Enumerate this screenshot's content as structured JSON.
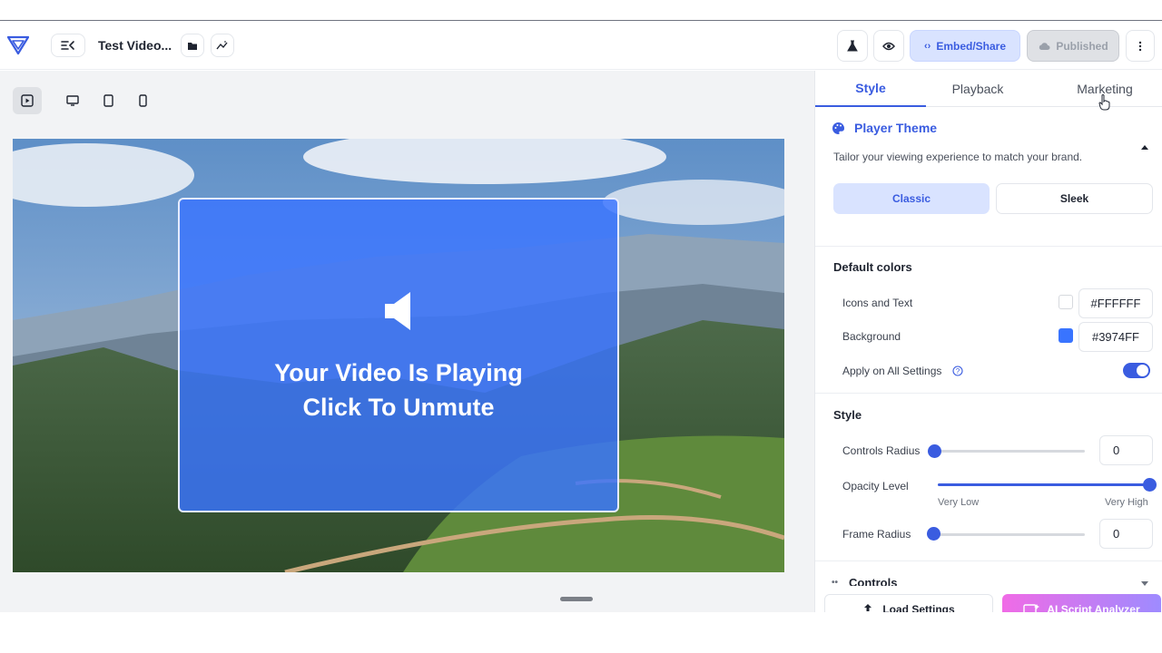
{
  "header": {
    "title": "Test Video...",
    "embed_label": "Embed/Share",
    "published_label": "Published"
  },
  "canvas": {
    "overlay_line1": "Your Video Is Playing",
    "overlay_line2": "Click To Unmute"
  },
  "tabs": [
    {
      "label": "Style",
      "active": true
    },
    {
      "label": "Playback",
      "active": false
    },
    {
      "label": "Marketing",
      "active": false
    }
  ],
  "player_theme": {
    "title": "Player Theme",
    "description": "Tailor your viewing experience to match your brand.",
    "options": [
      "Classic",
      "Sleek"
    ],
    "selected": "Classic"
  },
  "default_colors": {
    "title": "Default colors",
    "icons_text_label": "Icons and Text",
    "icons_text_value": "#FFFFFF",
    "background_label": "Background",
    "background_value": "#3974FF",
    "apply_all_label": "Apply on All Settings",
    "apply_all_on": true
  },
  "style": {
    "title": "Style",
    "controls_radius_label": "Controls Radius",
    "controls_radius_value": "0",
    "opacity_label": "Opacity Level",
    "opacity_low": "Very Low",
    "opacity_high": "Very High",
    "opacity_level": 1.0,
    "frame_radius_label": "Frame Radius",
    "frame_radius_value": "0"
  },
  "controls_section_title": "Controls",
  "footer": {
    "load_label": "Load Settings",
    "ai_label": "AI Script Analyzer"
  },
  "colors": {
    "accent": "#3A5CE0",
    "brand_blue": "#3974FF"
  }
}
